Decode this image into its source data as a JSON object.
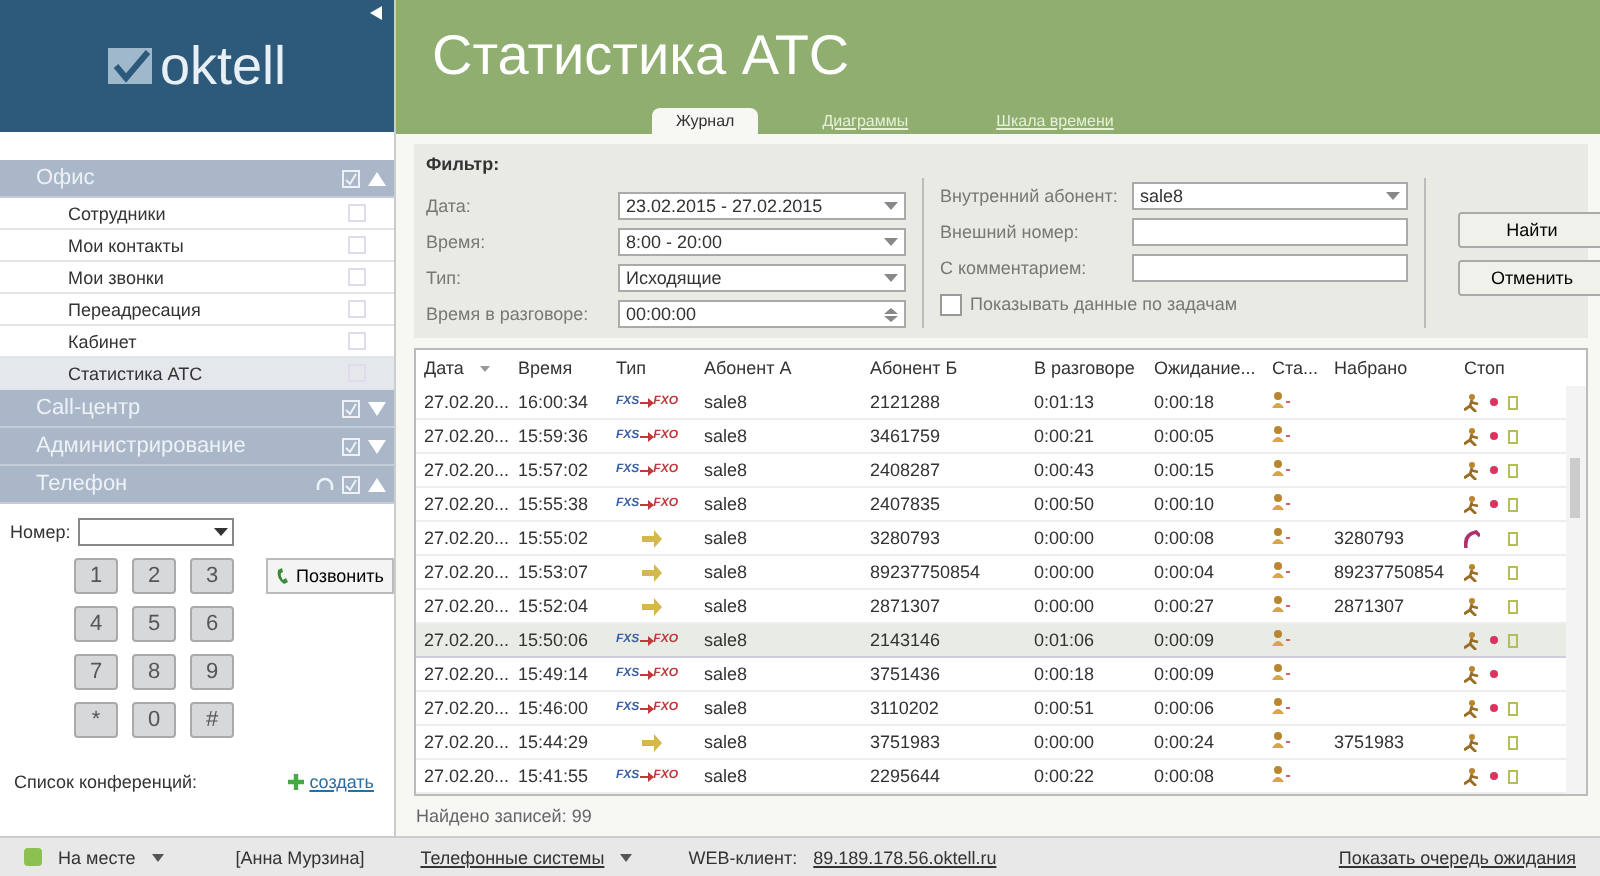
{
  "logo": {
    "text": "oktell"
  },
  "title": "Статистика АТС",
  "tabs": [
    {
      "label": "Журнал",
      "selected": true
    },
    {
      "label": "Диаграммы",
      "selected": false
    },
    {
      "label": "Шкала времени",
      "selected": false
    }
  ],
  "sidebar": {
    "sections": [
      {
        "label": "Офис",
        "expanded": true,
        "headset": false,
        "children": [
          {
            "label": "Сотрудники",
            "selected": false
          },
          {
            "label": "Мои контакты",
            "selected": false
          },
          {
            "label": "Мои звонки",
            "selected": false
          },
          {
            "label": "Переадресация",
            "selected": false
          },
          {
            "label": "Кабинет",
            "selected": false
          },
          {
            "label": "Статистика АТС",
            "selected": true
          }
        ]
      },
      {
        "label": "Call-центр",
        "expanded": false,
        "headset": false
      },
      {
        "label": "Администрирование",
        "expanded": false,
        "headset": false
      },
      {
        "label": "Телефон",
        "expanded": true,
        "headset": true
      }
    ]
  },
  "phone": {
    "number_label": "Номер:",
    "keys": [
      "1",
      "2",
      "3",
      "4",
      "5",
      "6",
      "7",
      "8",
      "9",
      "*",
      "0",
      "#"
    ],
    "call_button": "Позвонить",
    "conferences_label": "Список конференций:",
    "create_link": "создать"
  },
  "filter": {
    "title": "Фильтр:",
    "left": [
      {
        "label": "Дата:",
        "value": "23.02.2015 - 27.02.2015",
        "kind": "dropdown"
      },
      {
        "label": "Время:",
        "value": "8:00 - 20:00",
        "kind": "dropdown"
      },
      {
        "label": "Тип:",
        "value": "Исходящие",
        "kind": "dropdown"
      },
      {
        "label": "Время в разговоре:",
        "value": "00:00:00",
        "kind": "spin"
      }
    ],
    "right": [
      {
        "label": "Внутренний абонент:",
        "value": "sale8",
        "kind": "dropdown"
      },
      {
        "label": "Внешний номер:",
        "kind": "text"
      },
      {
        "label": "С комментарием:",
        "kind": "text"
      }
    ],
    "checkbox": {
      "label": "Показывать данные  по задачам",
      "checked": false
    },
    "buttons": [
      "Найти",
      "Отменить"
    ]
  },
  "table": {
    "columns": [
      "Дата",
      "Время",
      "Тип",
      "Абонент А",
      "Абонент Б",
      "В разговоре",
      "Ожидание...",
      "Ста...",
      "Набрано",
      "Стоп"
    ],
    "rows": [
      {
        "date": "27.02.20...",
        "time": "16:00:34",
        "type": {
          "kind": "trunk",
          "from": "FXS",
          "to": "FXO"
        },
        "a": "sale8",
        "b": "2121288",
        "talk": "0:01:13",
        "wait": "0:00:18",
        "stop": {
          "kind": "agent",
          "recorded": true,
          "note": true
        },
        "selected": false
      },
      {
        "date": "27.02.20...",
        "time": "15:59:36",
        "type": {
          "kind": "trunk",
          "from": "FXS",
          "to": "FXO"
        },
        "a": "sale8",
        "b": "3461759",
        "talk": "0:00:21",
        "wait": "0:00:05",
        "stop": {
          "kind": "agent",
          "recorded": true,
          "note": true
        },
        "selected": false
      },
      {
        "date": "27.02.20...",
        "time": "15:57:02",
        "type": {
          "kind": "trunk",
          "from": "FXS",
          "to": "FXO"
        },
        "a": "sale8",
        "b": "2408287",
        "talk": "0:00:43",
        "wait": "0:00:15",
        "stop": {
          "kind": "agent",
          "recorded": true,
          "note": true
        },
        "selected": false
      },
      {
        "date": "27.02.20...",
        "time": "15:55:38",
        "type": {
          "kind": "trunk",
          "from": "FXS",
          "to": "FXO"
        },
        "a": "sale8",
        "b": "2407835",
        "talk": "0:00:50",
        "wait": "0:00:10",
        "stop": {
          "kind": "agent",
          "recorded": true,
          "note": true
        },
        "selected": false
      },
      {
        "date": "27.02.20...",
        "time": "15:55:02",
        "type": {
          "kind": "forward"
        },
        "a": "sale8",
        "b": "3280793",
        "talk": "0:00:00",
        "wait": "0:00:08",
        "dialed": "3280793",
        "stop": {
          "kind": "handset",
          "recorded": false,
          "note": true
        },
        "selected": false
      },
      {
        "date": "27.02.20...",
        "time": "15:53:07",
        "type": {
          "kind": "forward"
        },
        "a": "sale8",
        "b": "89237750854",
        "talk": "0:00:00",
        "wait": "0:00:04",
        "dialed": "89237750854",
        "stop": {
          "kind": "agent",
          "recorded": false,
          "note": true
        },
        "selected": false
      },
      {
        "date": "27.02.20...",
        "time": "15:52:04",
        "type": {
          "kind": "forward"
        },
        "a": "sale8",
        "b": "2871307",
        "talk": "0:00:00",
        "wait": "0:00:27",
        "dialed": "2871307",
        "stop": {
          "kind": "agent",
          "recorded": false,
          "note": true
        },
        "selected": false
      },
      {
        "date": "27.02.20...",
        "time": "15:50:06",
        "type": {
          "kind": "trunk",
          "from": "FXS",
          "to": "FXO"
        },
        "a": "sale8",
        "b": "2143146",
        "talk": "0:01:06",
        "wait": "0:00:09",
        "stop": {
          "kind": "agent",
          "recorded": true,
          "note": true
        },
        "selected": true
      },
      {
        "date": "27.02.20...",
        "time": "15:49:14",
        "type": {
          "kind": "trunk",
          "from": "FXS",
          "to": "FXO"
        },
        "a": "sale8",
        "b": "3751436",
        "talk": "0:00:18",
        "wait": "0:00:09",
        "stop": {
          "kind": "agent",
          "recorded": true,
          "note": false
        },
        "selected": false
      },
      {
        "date": "27.02.20...",
        "time": "15:46:00",
        "type": {
          "kind": "trunk",
          "from": "FXS",
          "to": "FXO"
        },
        "a": "sale8",
        "b": "3110202",
        "talk": "0:00:51",
        "wait": "0:00:06",
        "stop": {
          "kind": "agent",
          "recorded": true,
          "note": true
        },
        "selected": false
      },
      {
        "date": "27.02.20...",
        "time": "15:44:29",
        "type": {
          "kind": "forward"
        },
        "a": "sale8",
        "b": "3751983",
        "talk": "0:00:00",
        "wait": "0:00:24",
        "dialed": "3751983",
        "stop": {
          "kind": "agent",
          "recorded": false,
          "note": true
        },
        "selected": false
      },
      {
        "date": "27.02.20...",
        "time": "15:41:55",
        "type": {
          "kind": "trunk",
          "from": "FXS",
          "to": "FXO"
        },
        "a": "sale8",
        "b": "2295644",
        "talk": "0:00:22",
        "wait": "0:00:08",
        "stop": {
          "kind": "agent",
          "recorded": true,
          "note": true
        },
        "selected": false
      }
    ]
  },
  "found": "Найдено записей: 99",
  "status_bar": {
    "presence": {
      "label": "На месте",
      "color": "#8cc152"
    },
    "user": "[Анна Мурзина]",
    "company": "Телефонные системы",
    "web_label": "WEB-клиент:",
    "web_link": "89.189.178.56.oktell.ru",
    "queue_link": "Показать очередь ожидания"
  }
}
